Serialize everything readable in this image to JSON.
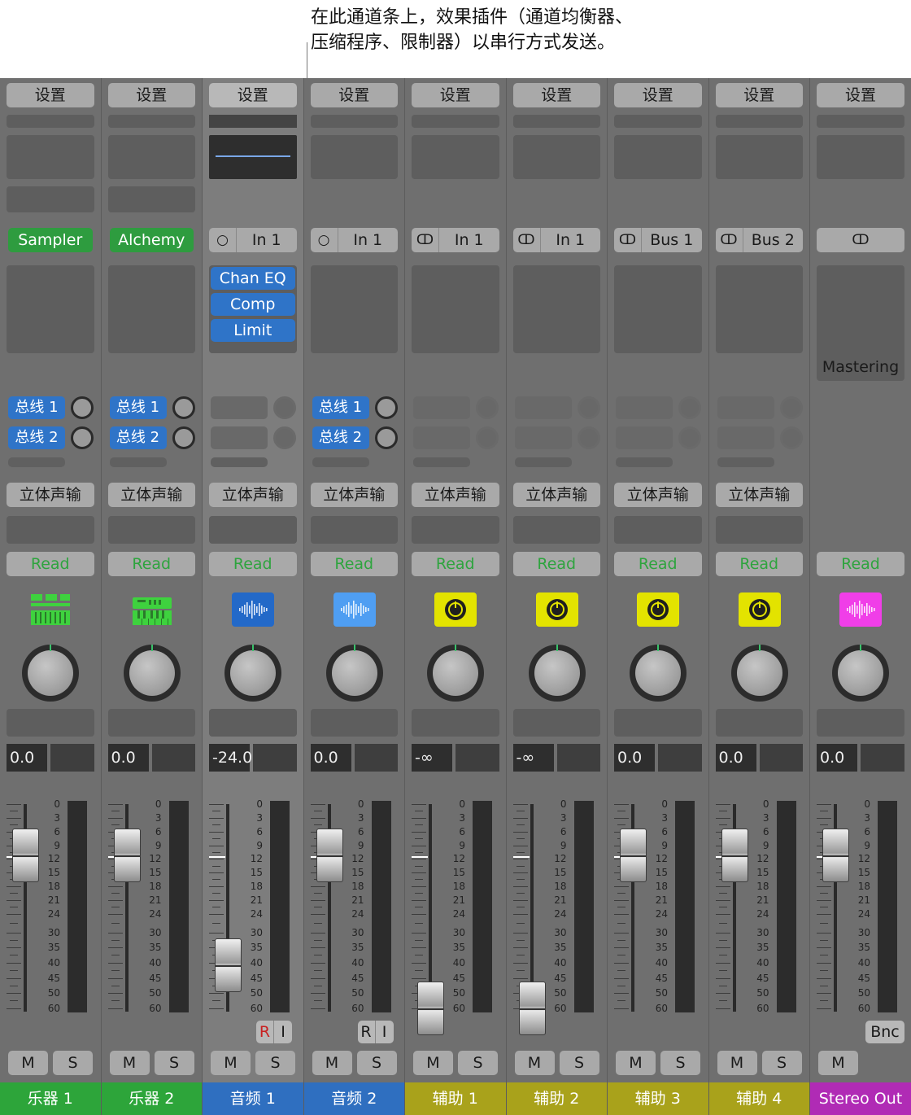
{
  "annotation": {
    "text": "在此通道条上，效果插件（通道均衡器、\n压缩程序、限制器）以串行方式发送。"
  },
  "mixer": {
    "strips": [
      {
        "settings": "设置",
        "eq": "empty",
        "input_type": "instrument",
        "instrument": "Sampler",
        "inserts": [],
        "sends": [
          "总线 1",
          "总线 2"
        ],
        "output": "立体声输",
        "automation": "Read",
        "icon": "sampler-icon",
        "icon_color": "#3ed23e",
        "volume": "0.0",
        "fader_db": 0,
        "record_buttons": null,
        "mute": "M",
        "solo": "S",
        "name": "乐器 1",
        "name_color": "#2da53a"
      },
      {
        "settings": "设置",
        "eq": "empty",
        "input_type": "instrument",
        "instrument": "Alchemy",
        "inserts": [],
        "sends": [
          "总线 1",
          "总线 2"
        ],
        "output": "立体声输",
        "automation": "Read",
        "icon": "keyboard-icon",
        "icon_color": "#3ed23e",
        "volume": "0.0",
        "fader_db": 0,
        "record_buttons": null,
        "mute": "M",
        "solo": "S",
        "name": "乐器 2",
        "name_color": "#2da53a"
      },
      {
        "settings": "设置",
        "eq": "thumbnail",
        "input_type": "audio",
        "input_symbol": "○",
        "input": "In 1",
        "inserts": [
          "Chan EQ",
          "Comp",
          "Limit"
        ],
        "sends": [],
        "output": "立体声输",
        "automation": "Read",
        "icon": "waveform-icon",
        "icon_color": "#2369c8",
        "volume": "-24.0",
        "fader_db": -24,
        "record_buttons": [
          "R",
          "I"
        ],
        "record_armed": true,
        "mute": "M",
        "solo": "S",
        "name": "音频 1",
        "name_color": "#2f6fc0",
        "selected": true
      },
      {
        "settings": "设置",
        "eq": "empty",
        "input_type": "audio",
        "input_symbol": "○",
        "input": "In 1",
        "inserts": [],
        "sends": [
          "总线 1",
          "总线 2"
        ],
        "output": "立体声输",
        "automation": "Read",
        "icon": "waveform-icon",
        "icon_color": "#4f9ef2",
        "volume": "0.0",
        "fader_db": 0,
        "record_buttons": [
          "R",
          "I"
        ],
        "record_armed": false,
        "mute": "M",
        "solo": "S",
        "name": "音频 2",
        "name_color": "#2f6fc0"
      },
      {
        "settings": "设置",
        "eq": "empty",
        "input_type": "audio",
        "input_symbol": "ↀ",
        "input": "In 1",
        "inserts": [],
        "sends": [],
        "output": "立体声输",
        "automation": "Read",
        "icon": "aux-knob-icon",
        "icon_color": "#e3e300",
        "volume": "-∞",
        "fader_db": -60,
        "record_buttons": null,
        "mute": "M",
        "solo": "S",
        "name": "辅助 1",
        "name_color": "#a9a21b"
      },
      {
        "settings": "设置",
        "eq": "empty",
        "input_type": "audio",
        "input_symbol": "ↀ",
        "input": "In 1",
        "inserts": [],
        "sends": [],
        "output": "立体声输",
        "automation": "Read",
        "icon": "aux-knob-icon",
        "icon_color": "#e3e300",
        "volume": "-∞",
        "fader_db": -60,
        "record_buttons": null,
        "mute": "M",
        "solo": "S",
        "name": "辅助 2",
        "name_color": "#a9a21b"
      },
      {
        "settings": "设置",
        "eq": "empty",
        "input_type": "audio",
        "input_symbol": "ↀ",
        "input": "Bus 1",
        "inserts": [],
        "sends": [],
        "output": "立体声输",
        "automation": "Read",
        "icon": "aux-knob-icon",
        "icon_color": "#e3e300",
        "volume": "0.0",
        "fader_db": 0,
        "record_buttons": null,
        "mute": "M",
        "solo": "S",
        "name": "辅助 3",
        "name_color": "#a9a21b"
      },
      {
        "settings": "设置",
        "eq": "empty",
        "input_type": "audio",
        "input_symbol": "ↀ",
        "input": "Bus 2",
        "inserts": [],
        "sends": [],
        "output": "立体声输",
        "automation": "Read",
        "icon": "aux-knob-icon",
        "icon_color": "#e3e300",
        "volume": "0.0",
        "fader_db": 0,
        "record_buttons": null,
        "mute": "M",
        "solo": "S",
        "name": "辅助 4",
        "name_color": "#a9a21b"
      },
      {
        "settings": "设置",
        "eq": "empty",
        "input_type": "master",
        "input_symbol": "ↀ",
        "input": "",
        "inserts": [],
        "master_label": "Mastering",
        "sends": null,
        "output": null,
        "automation": "Read",
        "icon": "waveform-icon",
        "icon_color": "#f03ee8",
        "volume": "0.0",
        "fader_db": 0,
        "record_buttons": null,
        "bounce": "Bnc",
        "mute": "M",
        "solo": null,
        "name": "Stereo Out",
        "name_color": "#b02bb5"
      }
    ],
    "meter_scale": [
      "0",
      "3",
      "6",
      "9",
      "12",
      "15",
      "18",
      "21",
      "24",
      "30",
      "35",
      "40",
      "45",
      "50",
      "60"
    ]
  }
}
